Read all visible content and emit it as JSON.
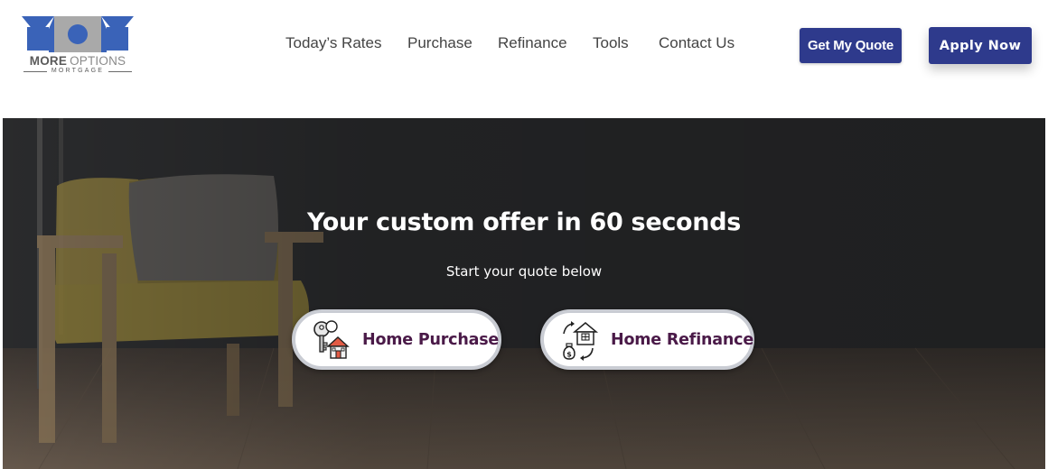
{
  "brand": {
    "name_part1": "MORE",
    "name_part2": "OPTIONS",
    "tagline": "MORTGAGE",
    "colors": {
      "blue": "#3a63b8",
      "gray": "#9a9a9a"
    }
  },
  "nav": {
    "items": [
      {
        "label": "Today’s Rates"
      },
      {
        "label": "Purchase"
      },
      {
        "label": "Refinance"
      },
      {
        "label": "Tools"
      },
      {
        "label": "Contact Us"
      }
    ]
  },
  "header_buttons": {
    "quote_label": "Get My Quote",
    "apply_label": "Apply Now",
    "accent": "#2e3a8c"
  },
  "hero": {
    "title": "Your custom offer in 60 seconds",
    "subtitle": "Start your quote below",
    "options": [
      {
        "label": "Home Purchase",
        "icon": "keys-house-icon"
      },
      {
        "label": "Home Refinance",
        "icon": "refinance-house-icon"
      }
    ],
    "label_color": "#4a1a48"
  }
}
